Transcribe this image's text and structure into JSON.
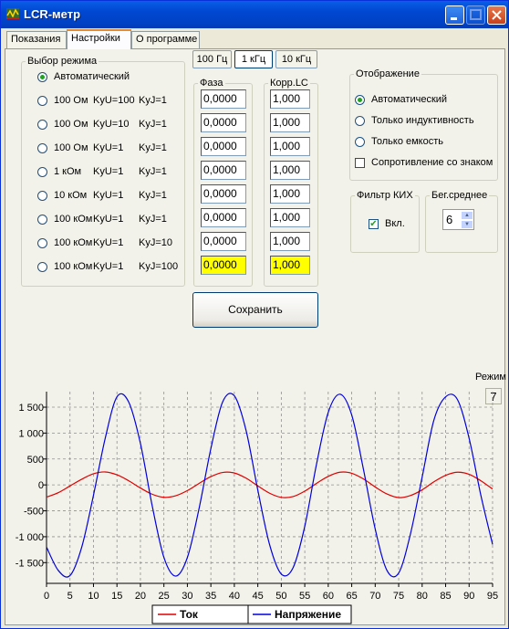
{
  "window": {
    "title": "LCR-метр"
  },
  "tabs": [
    {
      "label": "Показания"
    },
    {
      "label": "Настройки"
    },
    {
      "label": "О программе"
    }
  ],
  "mode_group": {
    "legend": "Выбор режима",
    "options": [
      {
        "c1": "Автоматический",
        "c2": "",
        "c3": "",
        "selected": true
      },
      {
        "c1": "100 Ом",
        "c2": "KyU=100",
        "c3": "KyJ=1",
        "selected": false
      },
      {
        "c1": "100 Ом",
        "c2": "KyU=10",
        "c3": "KyJ=1",
        "selected": false
      },
      {
        "c1": "100 Ом",
        "c2": "KyU=1",
        "c3": "KyJ=1",
        "selected": false
      },
      {
        "c1": "1 кОм",
        "c2": "KyU=1",
        "c3": "KyJ=1",
        "selected": false
      },
      {
        "c1": "10 кОм",
        "c2": "KyU=1",
        "c3": "KyJ=1",
        "selected": false
      },
      {
        "c1": "100 кОм",
        "c2": "KyU=1",
        "c3": "KyJ=1",
        "selected": false
      },
      {
        "c1": "100 кОм",
        "c2": "KyU=1",
        "c3": "KyJ=10",
        "selected": false
      },
      {
        "c1": "100 кОм",
        "c2": "KyU=1",
        "c3": "KyJ=100",
        "selected": false
      }
    ]
  },
  "freq_buttons": [
    {
      "label": "100 Гц",
      "selected": false
    },
    {
      "label": "1 кГц",
      "selected": true
    },
    {
      "label": "10 кГц",
      "selected": false
    }
  ],
  "phase_group": {
    "legend": "Фаза",
    "values": [
      "0,0000",
      "0,0000",
      "0,0000",
      "0,0000",
      "0,0000",
      "0,0000",
      "0,0000",
      "0,0000"
    ]
  },
  "corr_group": {
    "legend": "Корр.LC",
    "values": [
      "1,000",
      "1,000",
      "1,000",
      "1,000",
      "1,000",
      "1,000",
      "1,000",
      "1,000"
    ]
  },
  "highlight_color": "#ffff00",
  "save_button": "Сохранить",
  "display_group": {
    "legend": "Отображение",
    "radios": [
      {
        "label": "Автоматический",
        "selected": true
      },
      {
        "label": "Только индуктивность",
        "selected": false
      },
      {
        "label": "Только емкость",
        "selected": false
      }
    ],
    "checkbox": {
      "label": "Сопротивление со знаком",
      "checked": false
    }
  },
  "filter_group": {
    "legend": "Фильтр КИХ",
    "checkbox_label": "Вкл.",
    "checked": true
  },
  "avg_group": {
    "legend": "Бег.среднее",
    "value": "6"
  },
  "mode_indicator": {
    "label": "Режим",
    "value": "7"
  },
  "chart_data": {
    "type": "line",
    "xlim": [
      0,
      95
    ],
    "ylim": [
      -1900,
      1800
    ],
    "x_ticks": [
      0,
      5,
      10,
      15,
      20,
      25,
      30,
      35,
      40,
      45,
      50,
      55,
      60,
      65,
      70,
      75,
      80,
      85,
      90,
      95
    ],
    "y_ticks": [
      1500,
      1000,
      500,
      0,
      -500,
      -1000,
      -1500
    ],
    "y_tick_labels": [
      "1 500",
      "1 000",
      "500",
      "0",
      "-500",
      "-1 000",
      "-1 500"
    ],
    "grid": true,
    "legend_position": "bottom",
    "series": [
      {
        "name": "Ток",
        "color": "#e00000",
        "x": [
          0,
          2.5,
          5,
          7.5,
          10,
          12.5,
          15,
          17.5,
          20,
          22.5,
          25,
          27.5,
          30,
          32.5,
          35,
          37.5,
          40,
          42.5,
          45,
          47.5,
          50,
          52.5,
          55,
          57.5,
          60,
          62.5,
          65,
          67.5,
          70,
          72.5,
          75,
          77.5,
          80,
          82.5,
          85,
          87.5,
          90,
          92.5,
          95
        ],
        "values": [
          -235,
          -150,
          -20,
          110,
          215,
          250,
          195,
          80,
          -60,
          -180,
          -240,
          -210,
          -110,
          30,
          160,
          240,
          230,
          130,
          -20,
          -160,
          -240,
          -225,
          -120,
          30,
          165,
          245,
          225,
          115,
          -40,
          -175,
          -245,
          -205,
          -95,
          60,
          185,
          245,
          205,
          80,
          -80
        ]
      },
      {
        "name": "Напряжение",
        "color": "#0000dd",
        "x": [
          0,
          2.5,
          5,
          7.5,
          10,
          12.5,
          15,
          17.5,
          20,
          22.5,
          25,
          27.5,
          30,
          32.5,
          35,
          37.5,
          40,
          42.5,
          45,
          47.5,
          50,
          52.5,
          55,
          57.5,
          60,
          62.5,
          65,
          67.5,
          70,
          72.5,
          75,
          77.5,
          80,
          82.5,
          85,
          87.5,
          90,
          92.5,
          95
        ],
        "values": [
          -1200,
          -1650,
          -1750,
          -1200,
          -200,
          900,
          1700,
          1600,
          800,
          -400,
          -1400,
          -1760,
          -1400,
          -450,
          700,
          1600,
          1720,
          1050,
          -100,
          -1150,
          -1720,
          -1600,
          -800,
          400,
          1400,
          1750,
          1350,
          300,
          -850,
          -1650,
          -1700,
          -950,
          150,
          1250,
          1700,
          1650,
          900,
          -200,
          -1150
        ]
      }
    ]
  }
}
